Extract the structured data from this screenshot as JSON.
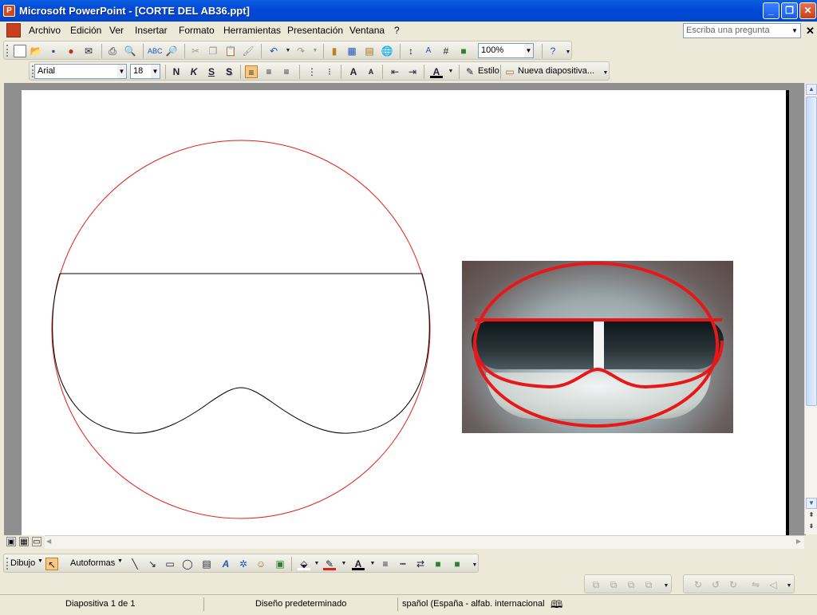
{
  "window": {
    "title": "Microsoft PowerPoint - [CORTE DEL AB36.ppt]"
  },
  "menu": {
    "items": [
      "Archivo",
      "Edición",
      "Ver",
      "Insertar",
      "Formato",
      "Herramientas",
      "Presentación",
      "Ventana",
      "?"
    ],
    "ask_placeholder": "Escriba una pregunta"
  },
  "toolbar_standard": {
    "zoom": "100%"
  },
  "toolbar_format": {
    "font": "Arial",
    "size": "18",
    "bold": "N",
    "italic": "K",
    "underline": "S",
    "shadow": "S",
    "style_label": "Estilo",
    "new_slide_label": "Nueva diapositiva..."
  },
  "drawing_toolbar": {
    "draw_label": "Dibujo",
    "autoshapes_label": "Autoformas"
  },
  "status": {
    "slide": "Diapositiva 1 de 1",
    "design": "Diseño predeterminado",
    "language": "spañol (España - alfab. internacional"
  },
  "colors": {
    "title_blue": "#0349d8",
    "outline_red": "#e0201a",
    "drawing_line": "#000000"
  }
}
